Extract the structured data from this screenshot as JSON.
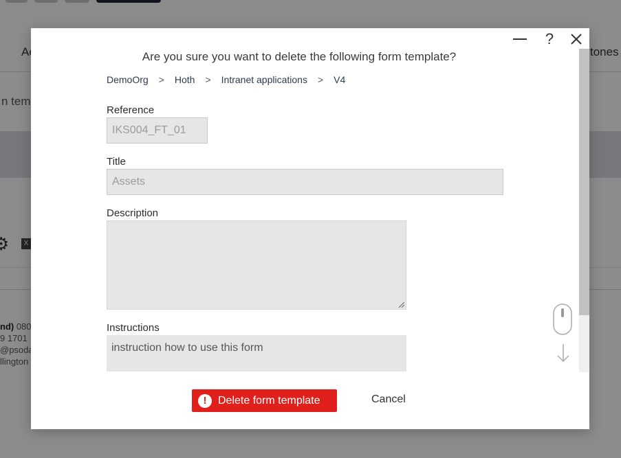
{
  "background": {
    "tab_left_fragment": "Ac",
    "tab_right_fragment": "tones",
    "subtitle_fragment": "n temp",
    "badge_letter": "X",
    "footer": {
      "line1_bold": "nd)",
      "line1_rest": " 080",
      "line2": "9 1701",
      "line3": "@psoda.",
      "line4": "llington"
    }
  },
  "dialog": {
    "controls": {
      "help_glyph": "?"
    },
    "question": "Are you sure you want to delete the following form template?",
    "breadcrumb": [
      "DemoOrg",
      "Hoth",
      "Intranet applications",
      "V4"
    ],
    "breadcrumb_separator": ">",
    "fields": {
      "reference": {
        "label": "Reference",
        "value": "IKS004_FT_01"
      },
      "title": {
        "label": "Title",
        "value": "Assets"
      },
      "description": {
        "label": "Description",
        "value": ""
      },
      "instructions": {
        "label": "Instructions",
        "value": "instruction how to use this form"
      }
    },
    "delete_button": {
      "icon_glyph": "!",
      "label": "Delete form template"
    },
    "cancel_button": {
      "label": "Cancel"
    }
  },
  "colors": {
    "danger": "#e0201c",
    "overlay": "rgba(0,0,0,0.45)",
    "field_background": "#e6e6e6",
    "band": "#d9dbe4"
  },
  "icons": [
    "minimize-icon",
    "help-icon",
    "close-icon",
    "mouse-scroll-icon",
    "arrow-down-icon",
    "alert-icon",
    "gear-icon"
  ]
}
